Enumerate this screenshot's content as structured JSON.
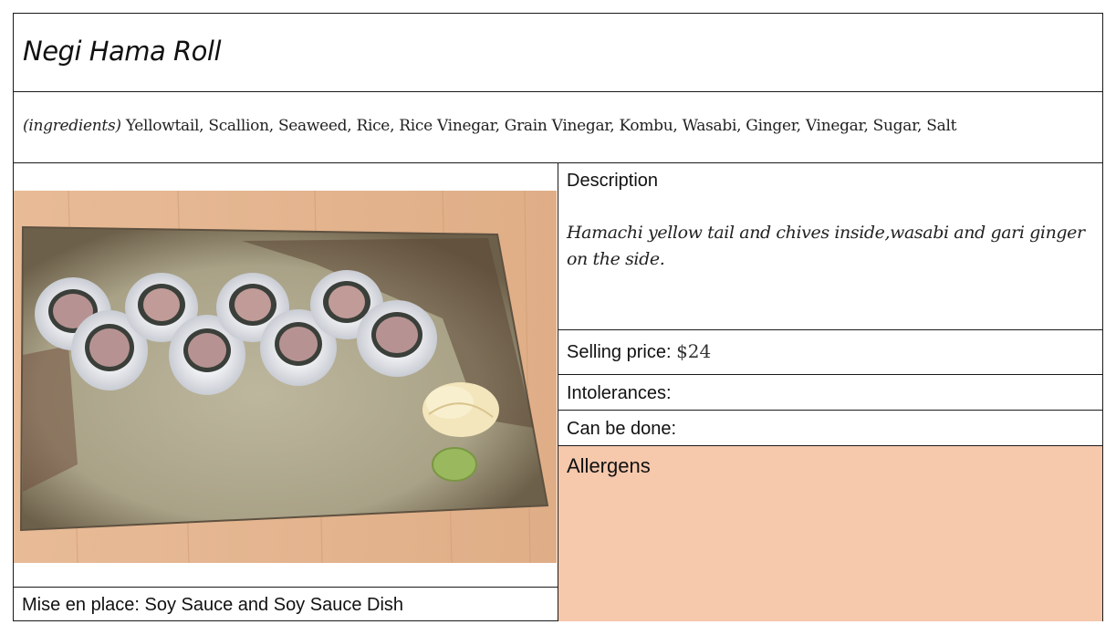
{
  "dish": {
    "name": "Negi Hama Roll",
    "ingredients_label": "(ingredients)",
    "ingredients": "Yellowtail, Scallion, Seaweed, Rice, Rice Vinegar, Grain Vinegar, Kombu, Wasabi, Ginger, Vinegar, Sugar, Salt"
  },
  "photo": {
    "subject": "negi hama roll on ceramic plate",
    "colors": {
      "table": "#e3b38e",
      "plate": "#b3ab92",
      "rice": "#e9ebee",
      "fish": "#b69392",
      "ginger": "#f3e6bc",
      "wasabi": "#9ab95e"
    }
  },
  "mise_en_place": "Mise en place: Soy Sauce and Soy Sauce Dish",
  "description": {
    "label": "Description",
    "text": "Hamachi yellow tail and chives inside,wasabi and gari ginger on the side."
  },
  "pricing": {
    "label": "Selling price:",
    "value": "$24"
  },
  "intolerances": {
    "label": "Intolerances:",
    "value": ""
  },
  "can_be_done": {
    "label": "Can be done:",
    "value": ""
  },
  "allergens": {
    "label": "Allergens",
    "color": "#f6c8ac"
  }
}
